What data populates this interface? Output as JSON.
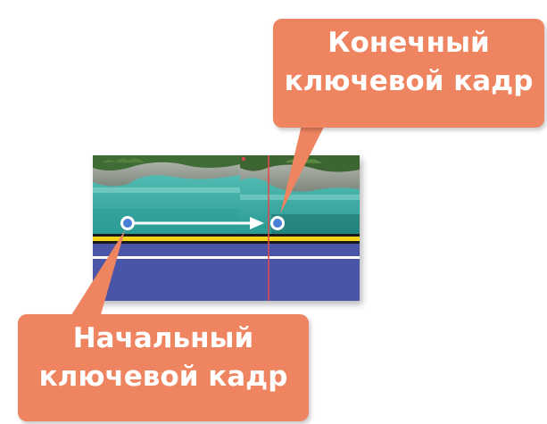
{
  "callouts": {
    "end_keyframe": {
      "line1": "Конечный",
      "line2": "ключевой кадр"
    },
    "start_keyframe": {
      "line1": "Начальный",
      "line2": "ключевой кадр"
    }
  },
  "colors": {
    "callout": "#ef8460",
    "audio_track": "#4a55a8",
    "yellow_stripe": "#f2d21a",
    "playhead": "#e8454a",
    "keyframe_dot": "#4a7fd8"
  },
  "icons": {
    "start_keyframe": "keyframe-dot-icon",
    "end_keyframe": "keyframe-dot-icon",
    "motion_path": "arrow-right-icon"
  }
}
